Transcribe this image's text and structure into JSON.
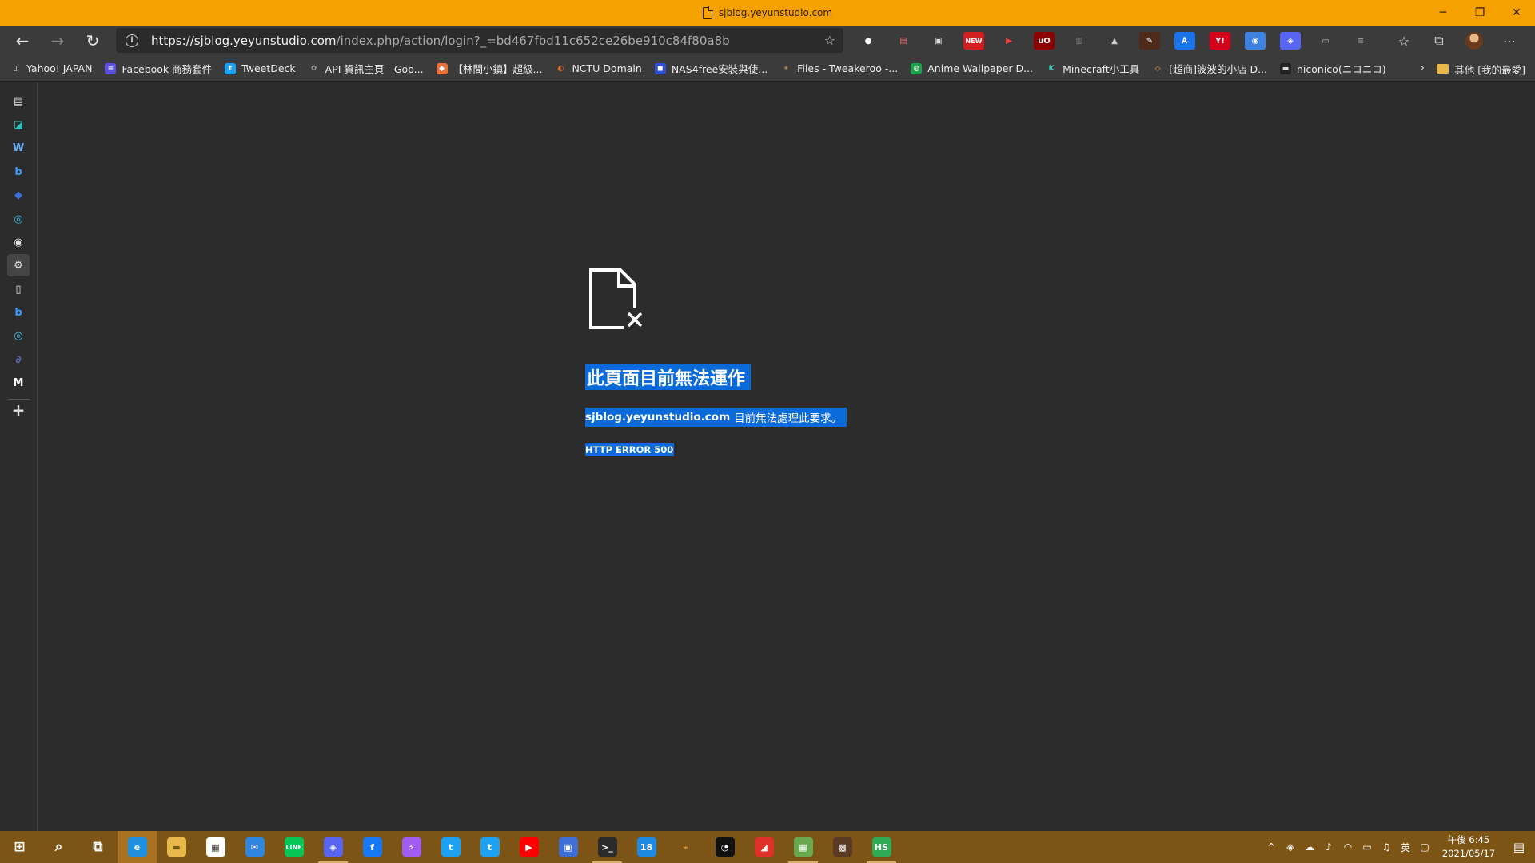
{
  "window": {
    "title": "sjblog.yeyunstudio.com",
    "minimize": "─",
    "restore": "❐",
    "close": "✕"
  },
  "toolbar": {
    "back": "←",
    "forward": "→",
    "refresh": "↻",
    "url_host": "https://sjblog.yeyunstudio.com",
    "url_path": "/index.php/action/login?_=bd467fbd11c652ce26be910c84f80a8b",
    "favorites_add": "☆",
    "favorites": "☆",
    "collections": "⧉",
    "more": "⋯",
    "extensions": [
      {
        "name": "tampermonkey-icon",
        "glyph": "●",
        "color": "#ffffff",
        "bg": "transparent"
      },
      {
        "name": "printer-icon",
        "glyph": "▤",
        "color": "#e46a6a",
        "bg": "transparent"
      },
      {
        "name": "bookmark-manager-icon",
        "glyph": "▣",
        "color": "#dcdcdc",
        "bg": "transparent"
      },
      {
        "name": "new-badge-extension-icon",
        "glyph": "NEW",
        "color": "#ffffff",
        "bg": "#d11f1f"
      },
      {
        "name": "video-downloader-icon",
        "glyph": "▶",
        "color": "#ff3b3b",
        "bg": "transparent"
      },
      {
        "name": "ublock-origin-icon",
        "glyph": "uO",
        "color": "#ffffff",
        "bg": "#8b0000"
      },
      {
        "name": "reader-mode-icon",
        "glyph": "▥",
        "color": "#777777",
        "bg": "transparent"
      },
      {
        "name": "hat-extension-icon",
        "glyph": "▲",
        "color": "#cfcfcf",
        "bg": "transparent"
      },
      {
        "name": "color-picker-icon",
        "glyph": "✎",
        "color": "#ffffff",
        "bg": "#4d2a1a"
      },
      {
        "name": "translate-icon",
        "glyph": "Ꭺ",
        "color": "#ffffff",
        "bg": "#1a73e8"
      },
      {
        "name": "yahoo-icon",
        "glyph": "Y!",
        "color": "#ffffff",
        "bg": "#d4001a"
      },
      {
        "name": "chat-extension-icon",
        "glyph": "◉",
        "color": "#ffffff",
        "bg": "#3d82e0"
      },
      {
        "name": "discord-extension-icon",
        "glyph": "◈",
        "color": "#ffffff",
        "bg": "#5865f2"
      },
      {
        "name": "comment-icon",
        "glyph": "▭",
        "color": "#bdbdbd",
        "bg": "transparent"
      },
      {
        "name": "filter-icon",
        "glyph": "≡",
        "color": "#9a9a9a",
        "bg": "transparent"
      }
    ]
  },
  "bookmarks": {
    "items": [
      {
        "label": "Yahoo! JAPAN",
        "glyph": "▯",
        "bg": "transparent",
        "color": "#ffffff"
      },
      {
        "label": "Facebook 商務套件",
        "glyph": "≡",
        "bg": "#5b4fe0",
        "color": "#ffffff"
      },
      {
        "label": "TweetDeck",
        "glyph": "t",
        "bg": "#1da1f2",
        "color": "#ffffff"
      },
      {
        "label": "API 資訊主頁 - Goo...",
        "glyph": "✿",
        "bg": "transparent",
        "color": "#9aa0a6"
      },
      {
        "label": "【林間小鎮】超級...",
        "glyph": "◆",
        "bg": "#e8703a",
        "color": "#ffffff"
      },
      {
        "label": "NCTU Domain",
        "glyph": "◐",
        "bg": "transparent",
        "color": "#e86a2a"
      },
      {
        "label": "NAS4free安裝與使...",
        "glyph": "◼",
        "bg": "#2f4fd6",
        "color": "#ffffff"
      },
      {
        "label": "Files - Tweakeroo -...",
        "glyph": "✶",
        "bg": "transparent",
        "color": "#b58a5a"
      },
      {
        "label": "Anime Wallpaper D...",
        "glyph": "◍",
        "bg": "#1aa34a",
        "color": "#ffffff"
      },
      {
        "label": "Minecraft小工具",
        "glyph": "K",
        "bg": "transparent",
        "color": "#38d3c6"
      },
      {
        "label": "[超商]波波的小店 D...",
        "glyph": "◇",
        "bg": "transparent",
        "color": "#f0a33a"
      },
      {
        "label": "niconico(ニコニコ)",
        "glyph": "▬",
        "bg": "#222222",
        "color": "#dddddd"
      }
    ],
    "more": "›",
    "other": "其他 [我的最愛]"
  },
  "sidebar": {
    "items": [
      {
        "name": "sidebar-collections-icon",
        "glyph": "▤",
        "color": "#e0e0e0"
      },
      {
        "name": "sidebar-translate-icon",
        "glyph": "◪",
        "color": "#2fc0c0"
      },
      {
        "name": "sidebar-wordpress-icon",
        "glyph": "W",
        "color": "#6ab0ff"
      },
      {
        "name": "sidebar-bing-icon",
        "glyph": "b",
        "color": "#3a96ff"
      },
      {
        "name": "sidebar-notes-icon",
        "glyph": "◆",
        "color": "#3d6fd6"
      },
      {
        "name": "sidebar-outlook-icon",
        "glyph": "◎",
        "color": "#3bc0e8"
      },
      {
        "name": "sidebar-github-icon",
        "glyph": "◉",
        "color": "#e0e0e0"
      },
      {
        "name": "sidebar-page-settings-icon",
        "glyph": "⚙",
        "color": "#e0e0e0"
      },
      {
        "name": "sidebar-page-icon",
        "glyph": "▯",
        "color": "#e0e0e0"
      },
      {
        "name": "sidebar-bing-2-icon",
        "glyph": "b",
        "color": "#3a96ff"
      },
      {
        "name": "sidebar-outlook-2-icon",
        "glyph": "◎",
        "color": "#3bc0e8"
      },
      {
        "name": "sidebar-link-icon",
        "glyph": "∂",
        "color": "#5a6aa8"
      },
      {
        "name": "sidebar-m-app-icon",
        "glyph": "M",
        "color": "#ffffff"
      },
      {
        "name": "sidebar-add-icon",
        "glyph": "+",
        "color": "#e0e0e0"
      }
    ]
  },
  "error": {
    "title": "此頁面目前無法運作",
    "host": "sjblog.yeyunstudio.com",
    "message": "目前無法處理此要求。",
    "code": "HTTP ERROR 500"
  },
  "taskbar": {
    "apps": [
      {
        "name": "taskbar-start-icon",
        "glyph": "⊞",
        "bg": "transparent",
        "color": "#ffffff",
        "state": ""
      },
      {
        "name": "taskbar-search-icon",
        "glyph": "⌕",
        "bg": "transparent",
        "color": "#ffffff",
        "state": ""
      },
      {
        "name": "taskbar-task-view-icon",
        "glyph": "⧉",
        "bg": "transparent",
        "color": "#ffffff",
        "state": ""
      },
      {
        "name": "taskbar-edge-icon",
        "glyph": "e",
        "bg": "#1f8fe0",
        "color": "#ffffff",
        "state": "focused"
      },
      {
        "name": "taskbar-file-explorer-icon",
        "glyph": "▬",
        "bg": "#e8b84a",
        "color": "#7a5a10",
        "state": ""
      },
      {
        "name": "taskbar-store-icon",
        "glyph": "▦",
        "bg": "#ffffff",
        "color": "#333333",
        "state": ""
      },
      {
        "name": "taskbar-mail-icon",
        "glyph": "✉",
        "bg": "#2f86e0",
        "color": "#ffffff",
        "state": ""
      },
      {
        "name": "taskbar-line-icon",
        "glyph": "LINE",
        "bg": "#06c755",
        "color": "#ffffff",
        "state": ""
      },
      {
        "name": "taskbar-discord-icon",
        "glyph": "◈",
        "bg": "#5865f2",
        "color": "#ffffff",
        "state": "running"
      },
      {
        "name": "taskbar-facebook-icon",
        "glyph": "f",
        "bg": "#1877f2",
        "color": "#ffffff",
        "state": ""
      },
      {
        "name": "taskbar-messenger-icon",
        "glyph": "⚡",
        "bg": "#a05cf0",
        "color": "#ffffff",
        "state": ""
      },
      {
        "name": "taskbar-twitter-icon",
        "glyph": "t",
        "bg": "#1da1f2",
        "color": "#ffffff",
        "state": ""
      },
      {
        "name": "taskbar-tweetdeck-icon",
        "glyph": "t",
        "bg": "#1da1f2",
        "color": "#ffffff",
        "state": ""
      },
      {
        "name": "taskbar-youtube-icon",
        "glyph": "▶",
        "bg": "#ff0000",
        "color": "#ffffff",
        "state": ""
      },
      {
        "name": "taskbar-remote-desktop-icon",
        "glyph": "▣",
        "bg": "#3d6fd6",
        "color": "#ffffff",
        "state": ""
      },
      {
        "name": "taskbar-terminal-icon",
        "glyph": ">_",
        "bg": "#2b2b2b",
        "color": "#ffffff",
        "state": "running"
      },
      {
        "name": "taskbar-notes-badge-icon",
        "glyph": "18",
        "bg": "#1e88e5",
        "color": "#ffffff",
        "state": ""
      },
      {
        "name": "taskbar-controller-icon",
        "glyph": "⌁",
        "bg": "transparent",
        "color": "#f0a33a",
        "state": ""
      },
      {
        "name": "taskbar-speedometer-icon",
        "glyph": "◔",
        "bg": "#111111",
        "color": "#ffffff",
        "state": ""
      },
      {
        "name": "taskbar-ribbon-app-icon",
        "glyph": "◢",
        "bg": "#e0302a",
        "color": "#ffffff",
        "state": ""
      },
      {
        "name": "taskbar-minecraft-icon",
        "glyph": "▦",
        "bg": "#6aa84f",
        "color": "#ffffff",
        "state": "running"
      },
      {
        "name": "taskbar-block-app-icon",
        "glyph": "▩",
        "bg": "#5a3a22",
        "color": "#ffffff",
        "state": ""
      },
      {
        "name": "taskbar-hs-app-icon",
        "glyph": "HS",
        "bg": "#2faa55",
        "color": "#ffffff",
        "state": "running"
      }
    ],
    "tray": [
      {
        "name": "tray-overflow-icon",
        "glyph": "^"
      },
      {
        "name": "tray-discord-icon",
        "glyph": "◈"
      },
      {
        "name": "tray-onedrive-icon",
        "glyph": "☁"
      },
      {
        "name": "tray-microphone-icon",
        "glyph": "♪"
      },
      {
        "name": "tray-network-icon",
        "glyph": "◠"
      },
      {
        "name": "tray-battery-icon",
        "glyph": "▭"
      },
      {
        "name": "tray-volume-icon",
        "glyph": "♫"
      },
      {
        "name": "tray-ime-label",
        "glyph": "英"
      },
      {
        "name": "tray-ime-mode-icon",
        "glyph": "▢"
      }
    ],
    "time": "午後 6:45",
    "date": "2021/05/17",
    "notifications": "▤"
  }
}
